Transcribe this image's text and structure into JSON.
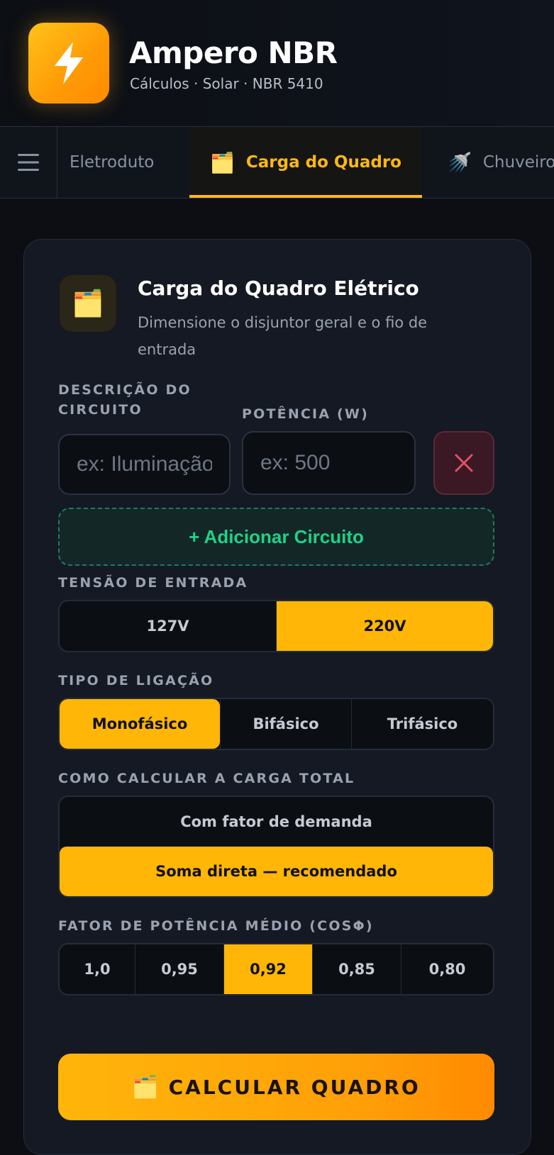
{
  "app": {
    "title": "Ampero NBR",
    "subtitle": "Cálculos · Solar · NBR 5410",
    "logo_icon": "lightning-bolt-icon"
  },
  "tabs": [
    {
      "label": "Eletroduto",
      "icon": "",
      "active": false
    },
    {
      "label": "Carga do Quadro",
      "icon": "🗂️",
      "active": true
    },
    {
      "label": "Chuveiro",
      "icon": "🚿",
      "active": false
    }
  ],
  "card": {
    "icon": "🗂️",
    "title": "Carga do Quadro Elétrico",
    "description": "Dimensione o disjuntor geral e o fio de entrada"
  },
  "circuit": {
    "description_label": "DESCRIÇÃO DO CIRCUITO",
    "description_placeholder": "ex: Iluminação",
    "description_value": "",
    "power_label": "POTÊNCIA (W)",
    "power_placeholder": "ex: 500",
    "power_value": "",
    "add_label": "+ Adicionar Circuito"
  },
  "voltage": {
    "label": "TENSÃO DE ENTRADA",
    "options": [
      "127V",
      "220V"
    ],
    "selected": "220V"
  },
  "connection": {
    "label": "TIPO DE LIGAÇÃO",
    "options": [
      "Monofásico",
      "Bifásico",
      "Trifásico"
    ],
    "selected": "Monofásico"
  },
  "load_method": {
    "label": "COMO CALCULAR A CARGA TOTAL",
    "options": [
      "Com fator de demanda",
      "Soma direta — recomendado"
    ],
    "selected": "Soma direta — recomendado"
  },
  "power_factor": {
    "label": "FATOR DE POTÊNCIA MÉDIO (COSΦ)",
    "options": [
      "1,0",
      "0,95",
      "0,92",
      "0,85",
      "0,80"
    ],
    "selected": "0,92"
  },
  "calculate": {
    "icon": "🗂️",
    "label": "CALCULAR QUADRO"
  },
  "colors": {
    "accent": "#ffb606",
    "background": "#0c0e13",
    "card": "#141923",
    "success": "#1fd18a",
    "danger": "#e0506f"
  }
}
